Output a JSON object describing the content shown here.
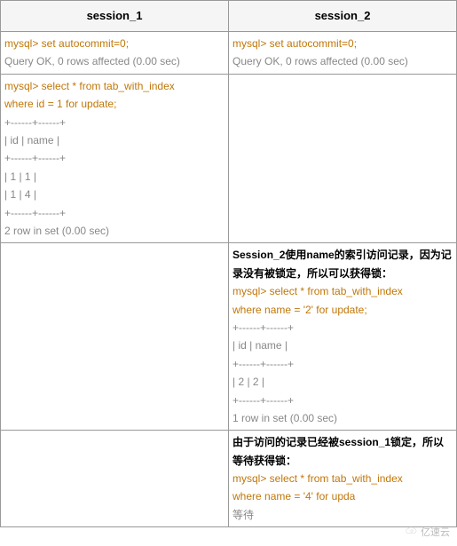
{
  "headers": {
    "col1": "session_1",
    "col2": "session_2"
  },
  "row1": {
    "s1_cmd": "mysql> set autocommit=0;",
    "s1_result": "Query OK, 0 rows affected (0.00 sec)",
    "s2_cmd": "mysql> set autocommit=0;",
    "s2_result": "Query OK, 0 rows affected (0.00 sec)"
  },
  "row2": {
    "s1_cmd1": "mysql> select * from tab_with_index",
    "s1_cmd2": "where id = 1 for update;",
    "s1_div1": "+------+------+",
    "s1_hdr": "| id       | name |",
    "s1_div2": "+------+------+",
    "s1_r1": "| 1        | 1       |",
    "s1_r2": "| 1        | 4       |",
    "s1_div3": "+------+------+",
    "s1_foot": "2 row in set (0.00 sec)"
  },
  "row3": {
    "s2_bold": "Session_2使用name的索引访问记录，因为记录没有被锁定，所以可以获得锁：",
    "s2_cmd1": "mysql> select * from tab_with_index",
    "s2_cmd2": "where name = '2' for update;",
    "s2_div1": "+------+------+",
    "s2_hdr": "| id       | name |",
    "s2_div2": "+------+------+",
    "s2_r1": "| 2        | 2       |",
    "s2_div3": "+------+------+",
    "s2_foot": "1 row in set (0.00 sec)"
  },
  "row4": {
    "s2_bold": "由于访问的记录已经被session_1锁定，所以等待获得锁：",
    "s2_cmd1": "mysql> select * from tab_with_index",
    "s2_cmd2": "where name = '4' for upda",
    "s2_wait": "等待"
  },
  "watermark": "亿速云"
}
